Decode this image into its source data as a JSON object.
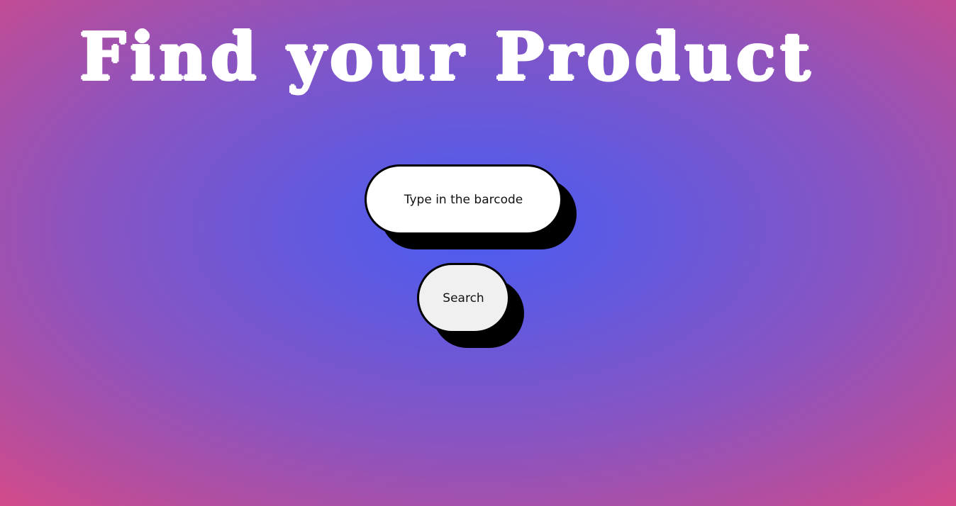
{
  "header": {
    "title": "Find your Product"
  },
  "search": {
    "placeholder": "Type in the barcode",
    "value": "",
    "button_label": "Search"
  },
  "colors": {
    "background_center": "#4a5cf0",
    "background_edge": "#d84a86",
    "title": "#ffffff",
    "input_background": "#ffffff",
    "button_background": "#f0f0f0",
    "shadow": "#000000"
  }
}
